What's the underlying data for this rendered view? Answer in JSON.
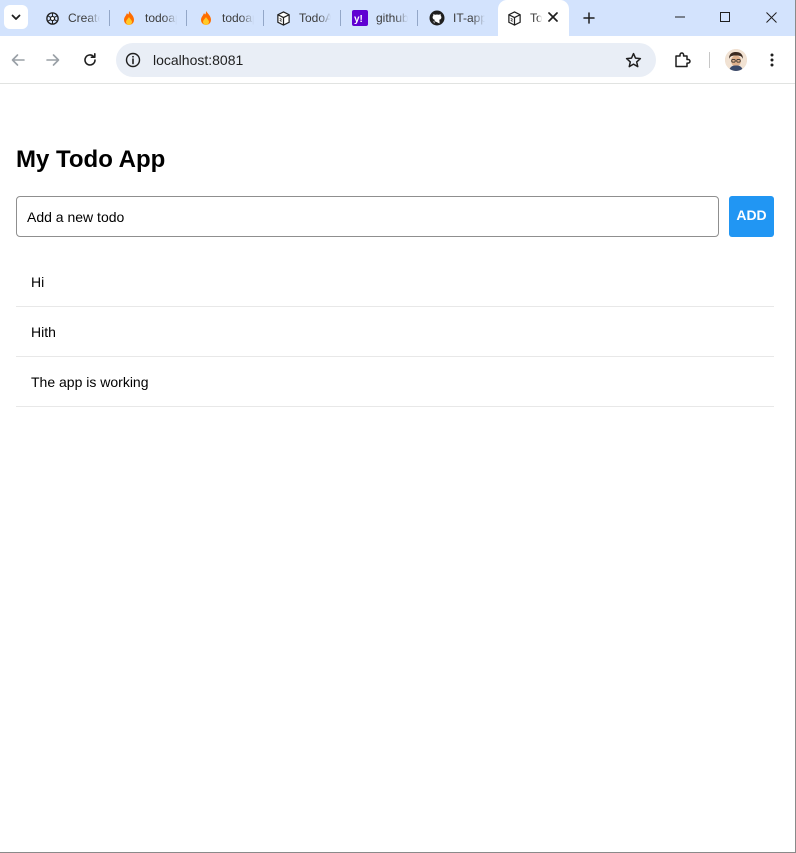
{
  "browser": {
    "tabs": [
      {
        "title": "Create",
        "favicon": "openai-icon"
      },
      {
        "title": "todoapp",
        "favicon": "firebase-icon"
      },
      {
        "title": "todoapp",
        "favicon": "firebase-icon"
      },
      {
        "title": "TodoApp",
        "favicon": "cube-icon"
      },
      {
        "title": "github",
        "favicon": "yahoo-icon"
      },
      {
        "title": "IT-app",
        "favicon": "github-icon"
      },
      {
        "title": "To",
        "favicon": "cube-icon",
        "active": true
      }
    ],
    "address": "localhost:8081",
    "colors": {
      "tabstrip": "#d3e3fd",
      "omnibox": "#e9eef6"
    }
  },
  "app": {
    "title": "My Todo App",
    "input_placeholder": "Add a new todo",
    "add_label": "ADD",
    "todos": [
      "Hi",
      "Hith",
      "The app is working"
    ],
    "colors": {
      "add_button": "#2196f3"
    }
  }
}
